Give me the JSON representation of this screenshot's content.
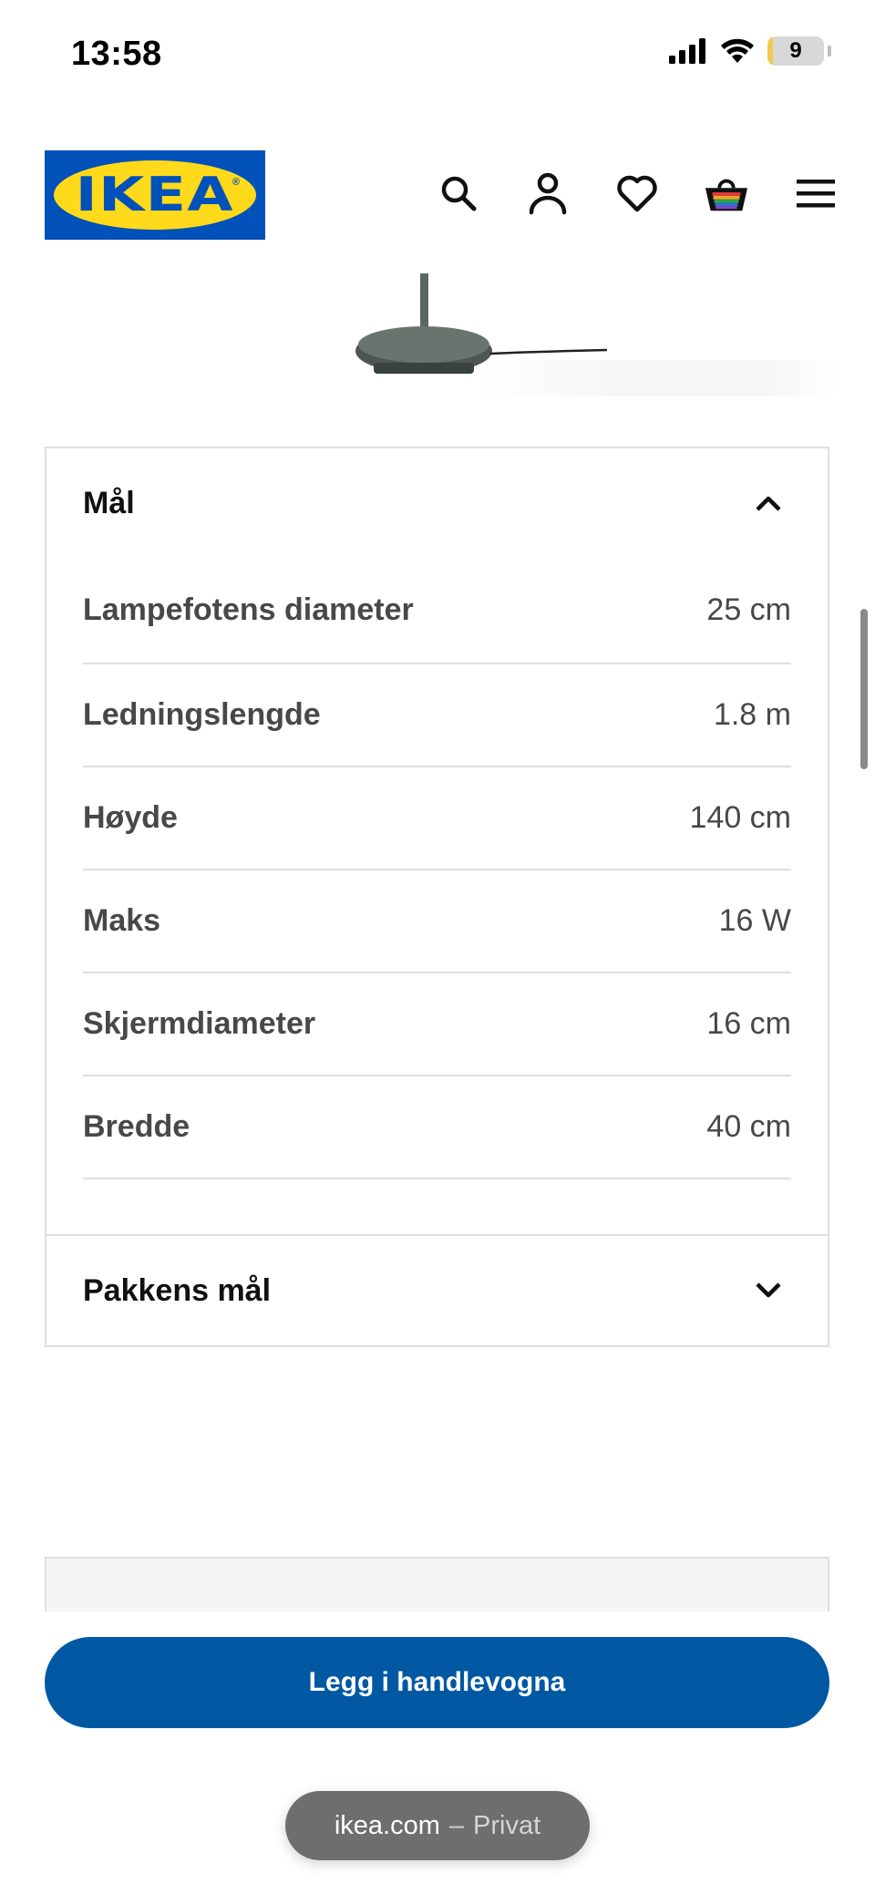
{
  "status_bar": {
    "time": "13:58",
    "battery_level": "9"
  },
  "header": {
    "logo_text": "IKEA",
    "icons": [
      "search-icon",
      "account-icon",
      "heart-icon",
      "basket-icon",
      "menu-icon"
    ]
  },
  "colors": {
    "brand_blue": "#0051ba",
    "brand_yellow": "#ffda1a",
    "button_blue": "#0058a3",
    "text_gray": "#484848"
  },
  "dimensions_section": {
    "title": "Mål",
    "expanded": true,
    "rows": [
      {
        "label": "Lampefotens diameter",
        "value": "25 cm"
      },
      {
        "label": "Ledningslengde",
        "value": "1.8 m"
      },
      {
        "label": "Høyde",
        "value": "140 cm"
      },
      {
        "label": "Maks",
        "value": "16 W"
      },
      {
        "label": "Skjermdiameter",
        "value": "16 cm"
      },
      {
        "label": "Bredde",
        "value": "40 cm"
      }
    ]
  },
  "package_section": {
    "title": "Pakkens mål",
    "expanded": false
  },
  "cart_button": {
    "label": "Legg i handlevogna"
  },
  "browser": {
    "domain": "ikea.com",
    "separator": "–",
    "mode": "Privat"
  }
}
